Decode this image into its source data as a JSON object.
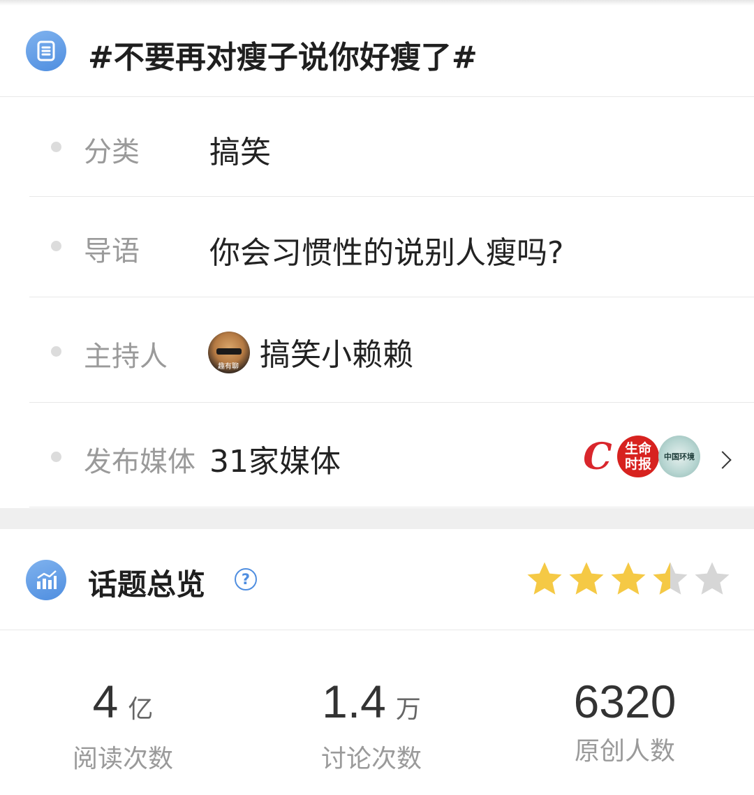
{
  "topic": {
    "icon": "document-list-icon",
    "title": "#不要再对瘦子说你好瘦了#"
  },
  "info": {
    "category": {
      "label": "分类",
      "value": "搞笑"
    },
    "intro": {
      "label": "导语",
      "value": "你会习惯性的说别人瘦吗?"
    },
    "host": {
      "label": "主持人",
      "name": "搞笑小赖赖",
      "avatar_caption": "趣有聊"
    },
    "media": {
      "label": "发布媒体",
      "value": "31家媒体",
      "logos": [
        {
          "name": "cctv-logo",
          "text": "C"
        },
        {
          "name": "shengming-shibao-logo",
          "line1": "生命",
          "line2": "时报"
        },
        {
          "name": "zhongguo-huanjing-logo",
          "text": "中国环境"
        }
      ]
    }
  },
  "overview": {
    "icon": "bar-chart-icon",
    "title": "话题总览",
    "help_icon": "question-circle-icon",
    "help_glyph": "?",
    "rating": 3.5,
    "rating_max": 5,
    "star_color": "#f5c945",
    "star_empty_color": "#d6d6d6"
  },
  "stats": [
    {
      "value": "4",
      "unit": "亿",
      "label": "阅读次数"
    },
    {
      "value": "1.4",
      "unit": "万",
      "label": "讨论次数"
    },
    {
      "value": "6320",
      "unit": "",
      "label": "原创人数"
    }
  ],
  "colors": {
    "accent": "#4f8ee0",
    "label_gray": "#9a9a9a",
    "divider": "#e8e8e8"
  }
}
